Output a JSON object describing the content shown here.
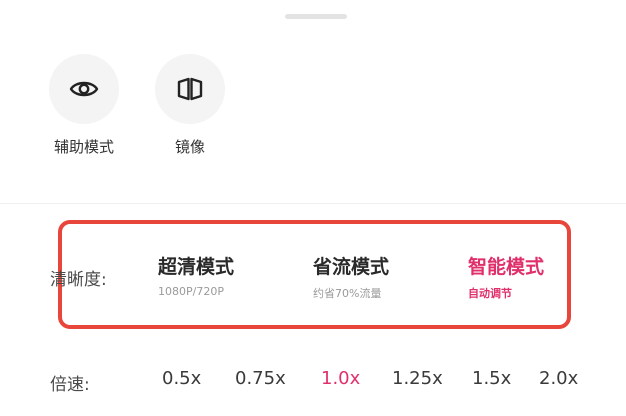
{
  "tools": [
    {
      "label": "辅助模式",
      "icon": "eye-icon"
    },
    {
      "label": "镜像",
      "icon": "mirror-icon"
    }
  ],
  "quality": {
    "label": "清晰度:",
    "options": [
      {
        "title": "超清模式",
        "subtitle": "1080P/720P",
        "selected": false
      },
      {
        "title": "省流模式",
        "subtitle": "约省70%流量",
        "selected": false
      },
      {
        "title": "智能模式",
        "subtitle": "自动调节",
        "selected": true
      }
    ]
  },
  "speed": {
    "label": "倍速:",
    "options": [
      "0.5x",
      "0.75x",
      "1.0x",
      "1.25x",
      "1.5x",
      "2.0x"
    ],
    "selected": "1.0x"
  },
  "colors": {
    "accent": "#e0306b",
    "highlight_box": "#e8463a",
    "icon_bg": "#f4f4f4"
  }
}
